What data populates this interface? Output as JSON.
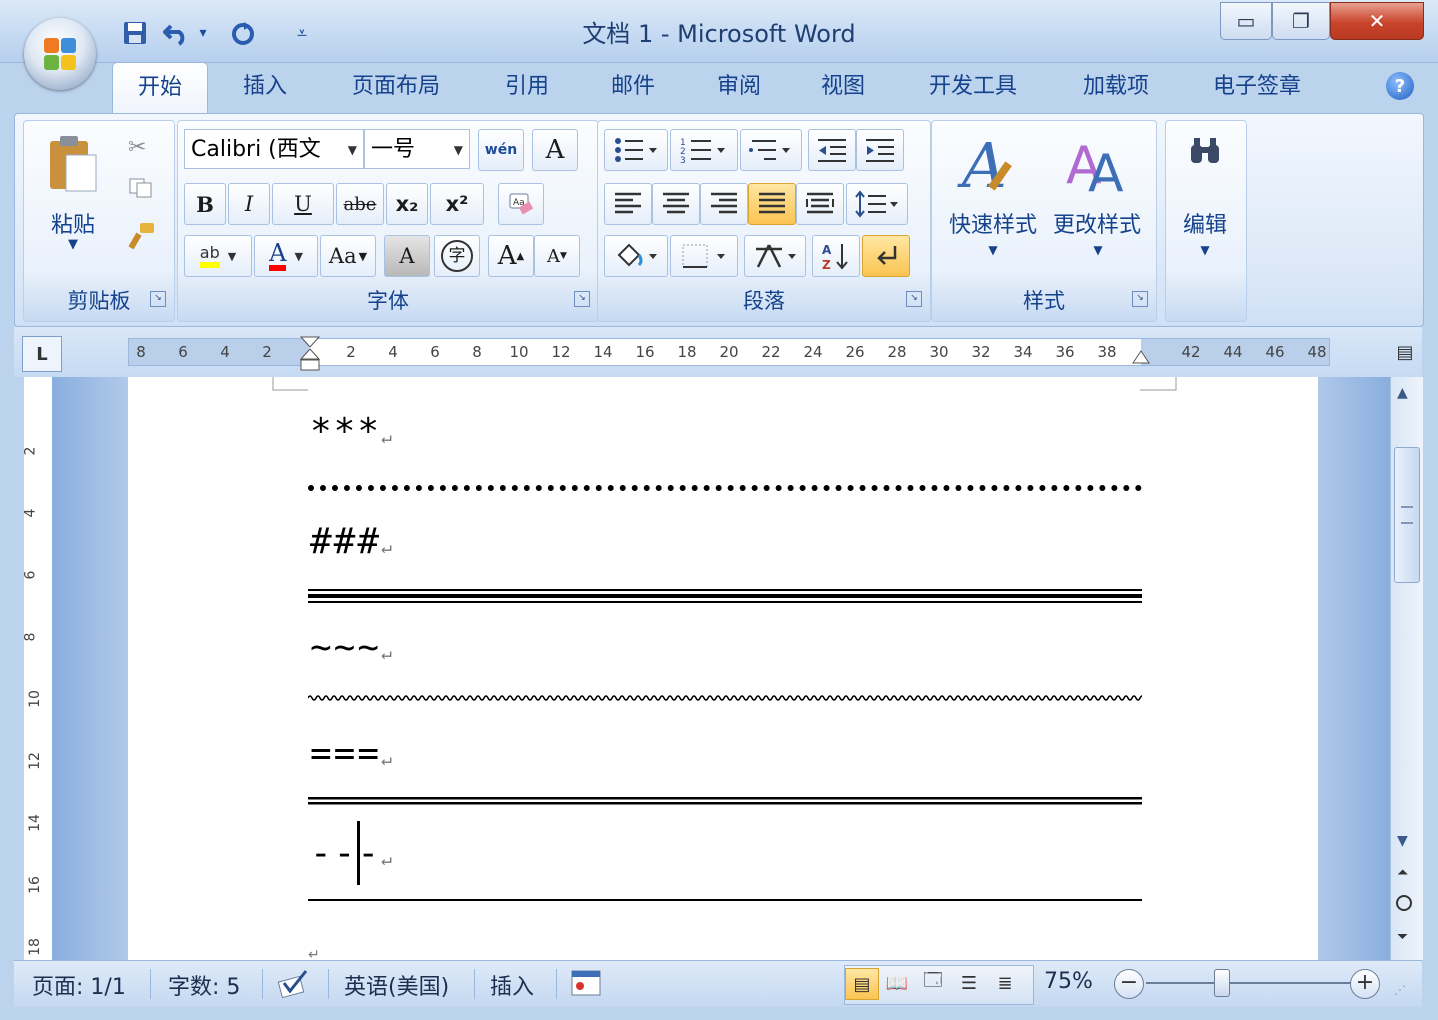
{
  "window": {
    "title": "文档 1 - Microsoft Word",
    "minimize_glyph": "▭",
    "restore_glyph": "❐",
    "close_glyph": "✕"
  },
  "quick_access": {
    "save_icon": "save-icon",
    "undo_icon": "undo-icon",
    "redo_icon": "redo-icon",
    "customize_icon": "customize-icon"
  },
  "tabs": [
    {
      "label": "开始",
      "active": true
    },
    {
      "label": "插入"
    },
    {
      "label": "页面布局"
    },
    {
      "label": "引用"
    },
    {
      "label": "邮件"
    },
    {
      "label": "审阅"
    },
    {
      "label": "视图"
    },
    {
      "label": "开发工具"
    },
    {
      "label": "加载项"
    },
    {
      "label": "电子签章"
    }
  ],
  "ribbon": {
    "clipboard": {
      "label": "剪贴板",
      "paste": "粘贴"
    },
    "font": {
      "label": "字体",
      "font_name": "Calibri (西文",
      "font_size": "一号",
      "bold": "B",
      "italic": "I",
      "underline": "U",
      "strike": "abe",
      "subscript": "x₂",
      "superscript": "x²",
      "grow": "A",
      "shrink": "A",
      "change_case": "Aa",
      "char_shading": "A",
      "enclose": "字",
      "font_color": "A",
      "highlight": "ab",
      "phonetic": "wén",
      "char_border": "A"
    },
    "paragraph": {
      "label": "段落"
    },
    "styles": {
      "label": "样式",
      "quick_styles": "快速样式",
      "change_styles": "更改样式"
    },
    "editing": {
      "label": "编辑"
    }
  },
  "ruler": {
    "h_numbers": [
      "8",
      "6",
      "4",
      "2",
      "2",
      "4",
      "6",
      "8",
      "10",
      "12",
      "14",
      "16",
      "18",
      "20",
      "22",
      "24",
      "26",
      "28",
      "30",
      "32",
      "34",
      "36",
      "38",
      "42",
      "44",
      "46",
      "48"
    ],
    "v_numbers": [
      "2",
      "4",
      "6",
      "8",
      "10",
      "12",
      "14",
      "16",
      "18"
    ]
  },
  "document": {
    "lines": [
      {
        "text": "***",
        "rule": "dotted"
      },
      {
        "text": "###",
        "rule": "triple"
      },
      {
        "text": "~~~",
        "rule": "wavy"
      },
      {
        "text": "===",
        "rule": "double"
      },
      {
        "text": "---",
        "rule": "single"
      }
    ],
    "para_mark": "↵"
  },
  "status": {
    "page": "页面: 1/1",
    "words": "字数: 5",
    "language": "英语(美国)",
    "mode": "插入",
    "zoom": "75%",
    "zoom_level": 0.75
  },
  "colors": {
    "ribbon_text": "#15428b",
    "highlight_yellow": "#ffff00",
    "font_red": "#ff0000"
  }
}
